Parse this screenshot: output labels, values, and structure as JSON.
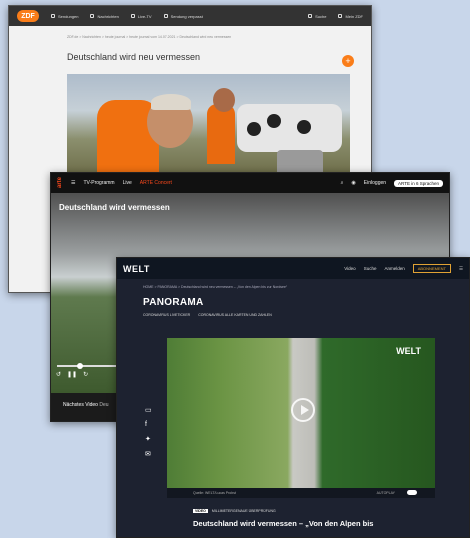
{
  "zdf": {
    "logo": "ZDF",
    "nav": [
      "Sendungen",
      "Nachrichten",
      "Live-TV",
      "Sendung verpasst"
    ],
    "right": [
      "Suche",
      "Mein ZDF"
    ],
    "breadcrumb": "ZDF.de > Nachrichten > heute journal > heute journal vom 14.07.2021 > Deutschland wird neu vermessen",
    "title": "Deutschland wird neu vermessen",
    "plus": "+"
  },
  "arte": {
    "logo": "arte",
    "menu": [
      "TV-Programm",
      "Live",
      "ARTE Concert"
    ],
    "login": "Einloggen",
    "languages": "ARTE in 6 Sprachen",
    "video_title": "Deutschland wird vermessen",
    "next": "Nächstes Video",
    "next_trunc": "Deu"
  },
  "welt": {
    "logo": "WELT",
    "menu": [
      "Video",
      "Suche",
      "Anmelden"
    ],
    "abo": "ABONNEMENT",
    "breadcrumb": "HOME > PANORAMA > Deutschland wird neu vermessen – „Von den Alpen bis zur Nordsee“",
    "section": "PANORAMA",
    "subnav": [
      "CORONAVIRUS LIVETICKER",
      "CORONAVIRUS ALLE KARTEN UND ZAHLEN"
    ],
    "video_logo": "WELT",
    "source": "Quelle: WELT/Lucas Probst",
    "autoplay": "AUTOPLAY",
    "tag_label": "VIDEO",
    "tag_text": "MILLIMETERGENAUE ÜBERPRÜFUNG",
    "headline": "Deutschland wird vermessen – „Von den Alpen bis"
  }
}
